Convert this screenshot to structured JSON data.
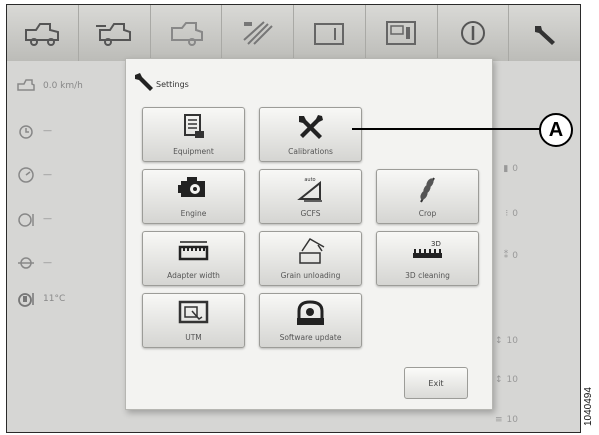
{
  "status": {
    "speed": "0.0 km/h",
    "engine_hours": "—",
    "fuel": "—",
    "level": "—",
    "axle": "—",
    "temperature": "11°C"
  },
  "right_values": {
    "r1": "0",
    "r2": "0",
    "r3": "0",
    "r4": "10",
    "r5": "10",
    "r6": "10"
  },
  "dialog": {
    "title": "Settings",
    "tiles": [
      {
        "label": "Equipment",
        "icon": "equipment-icon"
      },
      {
        "label": "Calibrations",
        "icon": "calibrations-icon"
      },
      {
        "label": "Engine",
        "icon": "engine-icon"
      },
      {
        "label": "GCFS",
        "icon": "gcfs-icon"
      },
      {
        "label": "Crop",
        "icon": "crop-icon"
      },
      {
        "label": "Adapter width",
        "icon": "adapter-width-icon"
      },
      {
        "label": "Grain unloading",
        "icon": "grain-unloading-icon"
      },
      {
        "label": "3D cleaning",
        "icon": "3d-cleaning-icon"
      },
      {
        "label": "UTM",
        "icon": "utm-icon"
      },
      {
        "label": "Software update",
        "icon": "software-update-icon"
      }
    ],
    "exit_label": "Exit"
  },
  "gcfs_icon_text": "auto",
  "cleaning_icon_text": "3D",
  "callout_label": "A",
  "figure_number": "1040494",
  "colors": {
    "background": "#d6d6d4",
    "dialog": "#f3f3f1",
    "icon": "#333333"
  }
}
